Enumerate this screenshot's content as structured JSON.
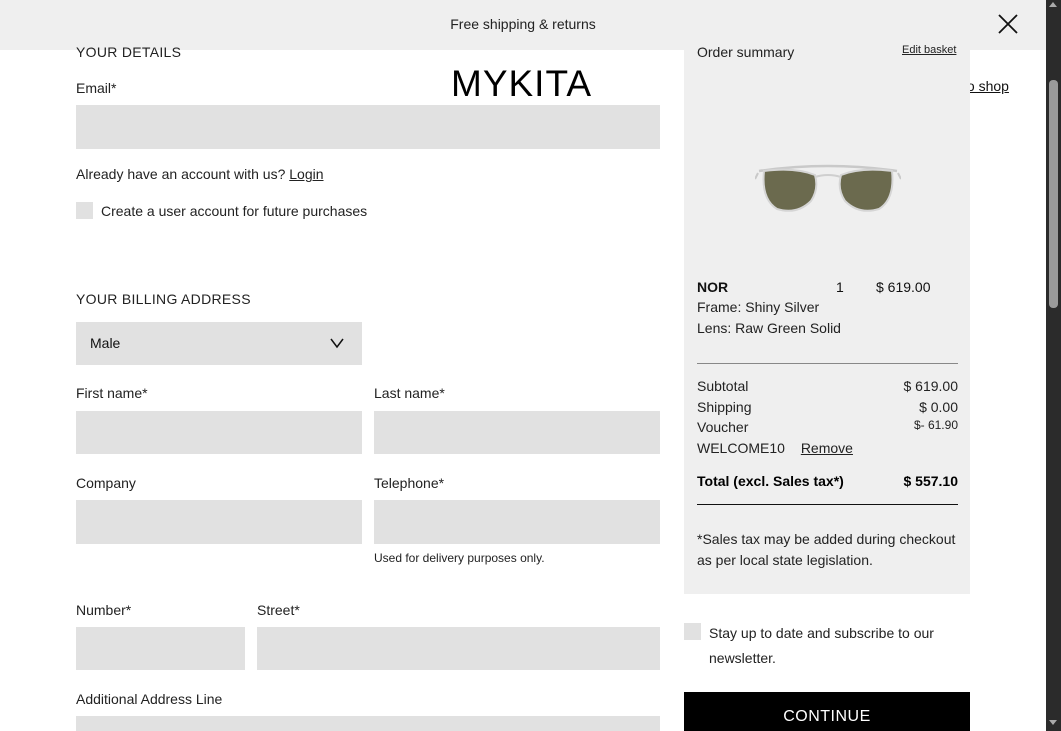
{
  "banner": {
    "text": "Free shipping & returns"
  },
  "brand": {
    "logo": "MYKITA",
    "back_to_shop": "Back to shop"
  },
  "details": {
    "title": "YOUR DETAILS",
    "email_label": "Email*",
    "email_value": "",
    "account_prompt": "Already have an account with us?",
    "login": "Login",
    "create_account": "Create a user account for future purchases"
  },
  "billing": {
    "title": "YOUR BILLING ADDRESS",
    "salutation": "Male",
    "first_name_label": "First name*",
    "last_name_label": "Last name*",
    "company_label": "Company",
    "telephone_label": "Telephone*",
    "telephone_hint": "Used for delivery purposes only.",
    "number_label": "Number*",
    "street_label": "Street*",
    "additional_label": "Additional Address Line"
  },
  "summary": {
    "title": "Order summary",
    "edit_basket": "Edit basket",
    "product": {
      "name": "NOR",
      "qty": "1",
      "price": "$ 619.00",
      "frame": "Frame: Shiny Silver",
      "lens": "Lens: Raw Green Solid"
    },
    "subtotal_label": "Subtotal",
    "subtotal_value": "$ 619.00",
    "shipping_label": "Shipping",
    "shipping_value": "$ 0.00",
    "voucher_label": "Voucher",
    "voucher_value": "$- 61.90",
    "voucher_code": "WELCOME10",
    "remove": "Remove",
    "total_label": "Total (excl. Sales tax*)",
    "total_value": "$ 557.10",
    "tax_note": "*Sales tax may be added during checkout as per local state legislation."
  },
  "newsletter": {
    "label": "Stay up to date and subscribe to our newsletter."
  },
  "actions": {
    "continue": "CONTINUE"
  },
  "icons": {
    "close": "close-icon",
    "chevron": "chevron-down-icon"
  },
  "colors": {
    "field_bg": "#e1e1e1",
    "panel_bg": "#efefef",
    "button_bg": "#000000"
  }
}
